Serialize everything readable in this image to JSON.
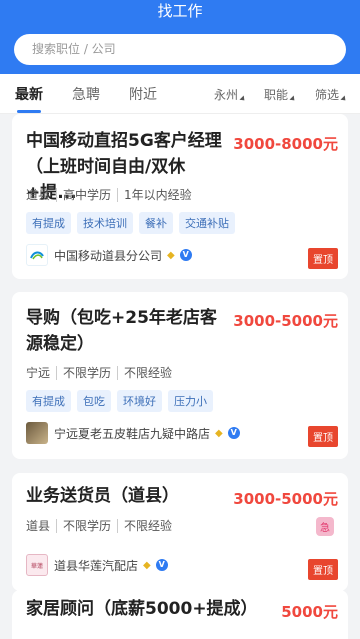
{
  "header": {
    "title": "找工作",
    "search_placeholder": "搜索职位 / 公司"
  },
  "tabs": [
    {
      "label": "最新",
      "active": true
    },
    {
      "label": "急聘",
      "active": false
    },
    {
      "label": "附近",
      "active": false
    }
  ],
  "filters": [
    {
      "label": "永州"
    },
    {
      "label": "职能"
    },
    {
      "label": "筛选"
    }
  ],
  "jobs": [
    {
      "title": "中国移动直招5G客户经理（上班时间自由/双休+提...",
      "salary": "3000-8000元",
      "location": "道县",
      "education": "高中学历",
      "experience": "1年以内经验",
      "tags": [
        "有提成",
        "技术培训",
        "餐补",
        "交通补贴"
      ],
      "company": "中国移动道县分公司",
      "logo_text": "中国移动 China Mobile",
      "pinned": "置顶"
    },
    {
      "title": "导购（包吃+25年老店客源稳定）",
      "salary": "3000-5000元",
      "location": "宁远",
      "education": "不限学历",
      "experience": "不限经验",
      "tags": [
        "有提成",
        "包吃",
        "环境好",
        "压力小"
      ],
      "company": "宁远夏老五皮鞋店九疑中路店",
      "pinned": "置顶"
    },
    {
      "title": "业务送货员（道县）",
      "salary": "3000-5000元",
      "location": "道县",
      "education": "不限学历",
      "experience": "不限经验",
      "company": "道县华莲汽配店",
      "logo_text": "华莲 汽配",
      "urgent": "急",
      "pinned": "置顶"
    },
    {
      "title": "家居顾问（底薪5000+提成）",
      "salary": "5000元"
    }
  ],
  "colors": {
    "primary": "#2f7bf2",
    "salary": "#f0483e",
    "pin": "#e8462e"
  }
}
